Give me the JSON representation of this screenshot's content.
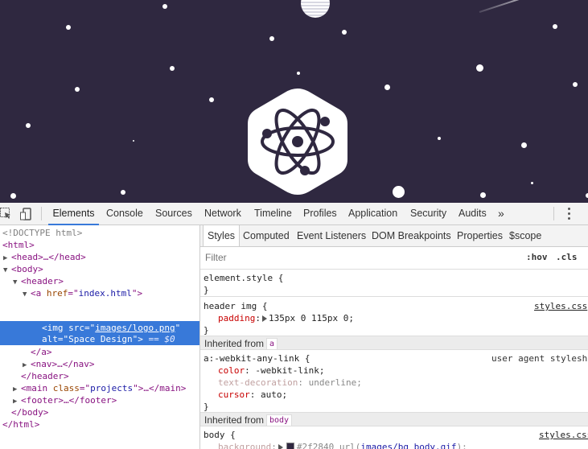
{
  "preview": {
    "background_color": "#2f2840",
    "logo_icon": "atom-icon"
  },
  "toolbar": {
    "tabs": [
      "Elements",
      "Console",
      "Sources",
      "Network",
      "Timeline",
      "Profiles",
      "Application",
      "Security",
      "Audits"
    ],
    "active_tab": "Elements",
    "more_label": "»",
    "icons": [
      "inspect-element-icon",
      "device-mode-icon",
      "more-tabs-icon",
      "kebab-menu-icon"
    ]
  },
  "dom": {
    "lines": [
      {
        "t": "<!DOCTYPE html>"
      },
      {
        "t": "<html>"
      },
      {
        "t": "<head>…</head>"
      },
      {
        "t": "<body>"
      },
      {
        "t": "<header>"
      },
      {
        "t": "<a href=\"index.html\">"
      },
      {
        "t": "<img src=\"images/logo.png\""
      },
      {
        "t": "alt=\"Space Design\"> == $0"
      },
      {
        "t": "</a>"
      },
      {
        "t": "<nav>…</nav>"
      },
      {
        "t": "</header>"
      },
      {
        "t": "<main class=\"projects\">…</main>"
      },
      {
        "t": "<footer>…</footer>"
      },
      {
        "t": "</body>"
      },
      {
        "t": "</html>"
      }
    ],
    "parts": {
      "doctype": "<!DOCTYPE html>",
      "html_open": "<html>",
      "head": "<head>…</head>",
      "body_open": "<body>",
      "header_open": "<header>",
      "a_tag": "<a",
      "a_attr": "href",
      "a_val": "index.html",
      "img_tag": "<img",
      "img_src_attr": "src",
      "img_src_val": "images/logo.png",
      "img_alt_attr": "alt",
      "img_alt_val": "Space Design",
      "dollar_ref": "== $0",
      "a_close": "</a>",
      "nav": "<nav>…</nav>",
      "header_close": "</header>",
      "main_tag": "<main",
      "main_attr": "class",
      "main_val": "projects",
      "main_close": ">…</main>",
      "footer": "<footer>…</footer>",
      "body_close": "</body>",
      "html_close": "</html>"
    }
  },
  "styles_pane": {
    "subtabs": [
      "Styles",
      "Computed",
      "Event Listeners",
      "DOM Breakpoints",
      "Properties",
      "$scope"
    ],
    "active_subtab": "Styles",
    "filter_placeholder": "Filter",
    "hov_label": ":hov",
    "cls_label": ".cls",
    "element_style": {
      "selector": "element.style {",
      "close": "}"
    },
    "header_img": {
      "selector": "header img {",
      "source": "styles.css",
      "prop": "padding",
      "value": "135px 0 115px 0;",
      "close": "}"
    },
    "inherited_a": {
      "label": "Inherited from",
      "chip": "a",
      "selector": "a:-webkit-any-link {",
      "source": "user agent stylesh",
      "props": [
        {
          "name": "color",
          "value": "-webkit-link;"
        },
        {
          "name": "text-decoration",
          "value": "underline;"
        },
        {
          "name": "cursor",
          "value": "auto;"
        }
      ],
      "close": "}"
    },
    "inherited_body": {
      "label": "Inherited from",
      "chip": "body",
      "selector": "body {",
      "source": "styles.css",
      "prop": "background",
      "swatch_color": "#2f2840",
      "value_hex": "#2f2840",
      "value_url_fn": "url(",
      "value_url": "images/bg_body.gif",
      "value_url_end": ");"
    }
  }
}
